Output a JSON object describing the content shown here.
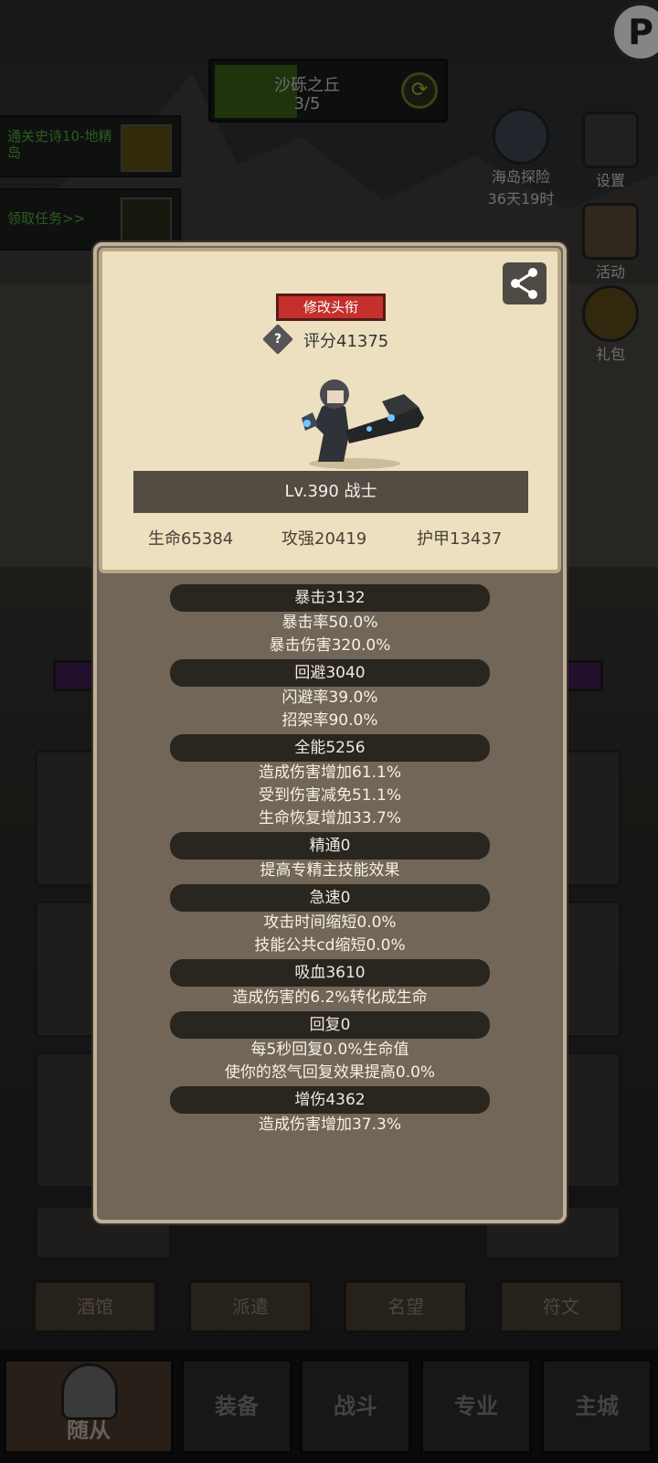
{
  "corner_badge": "P",
  "region": {
    "name": "沙砾之丘",
    "progress": "3/5",
    "progress_fraction": 0.6
  },
  "quests": [
    {
      "text": "通关史诗10-地精岛"
    },
    {
      "text": "领取任务>>"
    }
  ],
  "side_buttons": [
    {
      "label": "海岛探险",
      "sub": "36天19时",
      "icon": "island-icon"
    },
    {
      "label": "设置",
      "icon": "gear-icon"
    },
    {
      "label": "活动",
      "icon": "scroll-icon"
    },
    {
      "label": "礼包",
      "icon": "gift-icon"
    }
  ],
  "panel": {
    "title_button": "修改头衔",
    "score_icon": "?",
    "score": "评分41375",
    "level_class": "Lv.390 战士",
    "stats": {
      "hp": "生命65384",
      "atk": "攻强20419",
      "armor": "护甲13437"
    },
    "attributes": [
      {
        "header": "暴击3132",
        "lines": [
          "暴击率50.0%",
          "暴击伤害320.0%"
        ]
      },
      {
        "header": "回避3040",
        "lines": [
          "闪避率39.0%",
          "招架率90.0%"
        ]
      },
      {
        "header": "全能5256",
        "lines": [
          "造成伤害增加61.1%",
          "受到伤害减免51.1%",
          "生命恢复增加33.7%"
        ]
      },
      {
        "header": "精通0",
        "lines": [
          "提高专精主技能效果"
        ]
      },
      {
        "header": "急速0",
        "lines": [
          "攻击时间缩短0.0%",
          "技能公共cd缩短0.0%"
        ]
      },
      {
        "header": "吸血3610",
        "lines": [
          "造成伤害的6.2%转化成生命"
        ]
      },
      {
        "header": "回复0",
        "lines": [
          "每5秒回复0.0%生命值",
          "使你的怒气回复效果提高0.0%"
        ]
      },
      {
        "header": "增伤4362",
        "lines": [
          "造成伤害增加37.3%"
        ]
      }
    ]
  },
  "tabs": [
    "酒馆",
    "派遣",
    "名望",
    "符文"
  ],
  "bottom_nav": [
    {
      "label": "随从",
      "active": true
    },
    {
      "label": "装备",
      "active": false
    },
    {
      "label": "战斗",
      "active": false
    },
    {
      "label": "专业",
      "active": false
    },
    {
      "label": "主城",
      "active": false
    }
  ]
}
